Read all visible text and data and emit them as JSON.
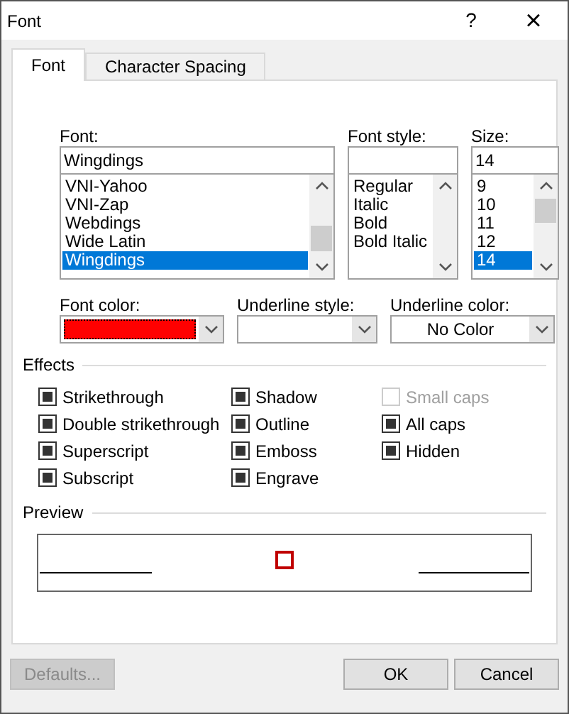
{
  "window": {
    "title": "Font",
    "help": "?",
    "close": "×"
  },
  "tabs": [
    {
      "label": "Font",
      "selected": true
    },
    {
      "label": "Character Spacing",
      "selected": false
    }
  ],
  "font": {
    "label": "Font:",
    "value": "Wingdings",
    "items": [
      {
        "label": "VNI-Yahoo",
        "selected": false
      },
      {
        "label": "VNI-Zap",
        "selected": false
      },
      {
        "label": "Webdings",
        "selected": false
      },
      {
        "label": "Wide Latin",
        "selected": false
      },
      {
        "label": "Wingdings",
        "selected": true
      }
    ]
  },
  "font_style": {
    "label": "Font style:",
    "items": [
      {
        "label": "Regular",
        "selected": false
      },
      {
        "label": "Italic",
        "selected": false
      },
      {
        "label": "Bold",
        "selected": false
      },
      {
        "label": "Bold Italic",
        "selected": false
      }
    ]
  },
  "size": {
    "label": "Size:",
    "value": "14",
    "items": [
      {
        "label": "9",
        "selected": false
      },
      {
        "label": "10",
        "selected": false
      },
      {
        "label": "11",
        "selected": false
      },
      {
        "label": "12",
        "selected": false
      },
      {
        "label": "14",
        "selected": true
      }
    ]
  },
  "font_color": {
    "label": "Font color:",
    "color": "#ff0000"
  },
  "underline_style": {
    "label": "Underline style:"
  },
  "underline_color": {
    "label": "Underline color:",
    "value": "No Color"
  },
  "effects": {
    "title": "Effects",
    "columns": [
      [
        {
          "label": "Strikethrough",
          "checked": false,
          "indeterminate": true,
          "disabled": false
        },
        {
          "label": "Double strikethrough",
          "checked": false,
          "indeterminate": true,
          "disabled": false
        },
        {
          "label": "Superscript",
          "checked": false,
          "indeterminate": true,
          "disabled": false
        },
        {
          "label": "Subscript",
          "checked": false,
          "indeterminate": true,
          "disabled": false
        }
      ],
      [
        {
          "label": "Shadow",
          "checked": false,
          "indeterminate": true,
          "disabled": false
        },
        {
          "label": "Outline",
          "checked": false,
          "indeterminate": true,
          "disabled": false
        },
        {
          "label": "Emboss",
          "checked": false,
          "indeterminate": true,
          "disabled": false
        },
        {
          "label": "Engrave",
          "checked": false,
          "indeterminate": true,
          "disabled": false
        }
      ],
      [
        {
          "label": "Small caps",
          "checked": false,
          "indeterminate": false,
          "disabled": true
        },
        {
          "label": "All caps",
          "checked": false,
          "indeterminate": true,
          "disabled": false
        },
        {
          "label": "Hidden",
          "checked": false,
          "indeterminate": true,
          "disabled": false
        }
      ]
    ]
  },
  "preview": {
    "title": "Preview"
  },
  "buttons": [
    {
      "label": "Defaults...",
      "disabled": true
    },
    {
      "label": "OK",
      "disabled": false
    },
    {
      "label": "Cancel",
      "disabled": false
    }
  ]
}
